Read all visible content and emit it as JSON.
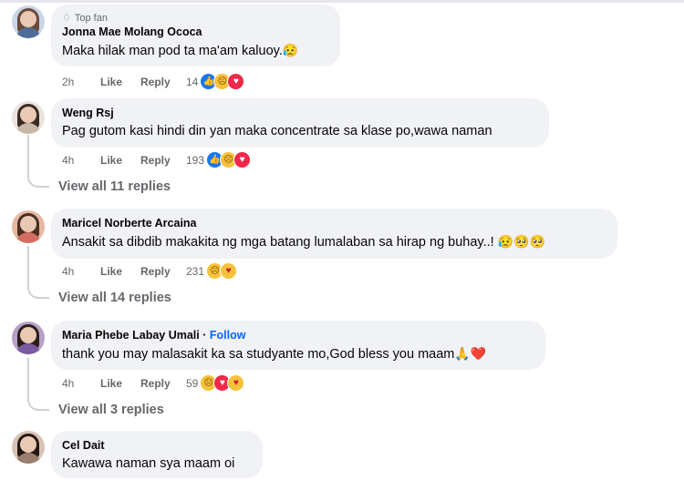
{
  "comments": [
    {
      "badge": "Top fan",
      "name": "Jonna Mae Molang Ococa",
      "text": "Maka hilak man pod ta ma'am kaluoy.",
      "text_emoji": "😥",
      "time": "2h",
      "like": "Like",
      "reply": "Reply",
      "count": "14",
      "reactions": [
        "like-icon",
        "sad-icon",
        "love-icon"
      ]
    },
    {
      "name": "Weng Rsj",
      "text": "Pag gutom kasi hindi din yan maka concentrate sa klase po,wawa naman",
      "time": "4h",
      "like": "Like",
      "reply": "Reply",
      "count": "193",
      "reactions": [
        "like-icon",
        "sad-icon",
        "love-icon"
      ],
      "view_replies": "View all 11 replies"
    },
    {
      "name": "Maricel Norberte Arcaina",
      "text": "Ansakit sa dibdib makakita ng mga batang lumalaban sa hirap ng buhay..!",
      "text_emoji": "😥🥺🥺",
      "time": "4h",
      "like": "Like",
      "reply": "Reply",
      "count": "231",
      "reactions": [
        "sad-icon",
        "care-icon"
      ],
      "view_replies": "View all 14 replies"
    },
    {
      "name": "Maria Phebe Labay Umali",
      "separator": "·",
      "follow": "Follow",
      "text": "thank you may malasakit ka sa studyante mo,God bless you maam",
      "text_emoji": "🙏❤️",
      "time": "4h",
      "like": "Like",
      "reply": "Reply",
      "count": "59",
      "reactions": [
        "sad-icon",
        "love-icon",
        "care-icon"
      ],
      "view_replies": "View all 3 replies"
    },
    {
      "name": "Cel Dait",
      "text": "Kawawa naman sya maam oi"
    }
  ],
  "colors": {
    "bubble": "#f0f2f5",
    "link": "#0866ff",
    "meta": "#65676b",
    "like": "#1877f2",
    "love": "#f02849",
    "sad": "#f7c23a"
  }
}
